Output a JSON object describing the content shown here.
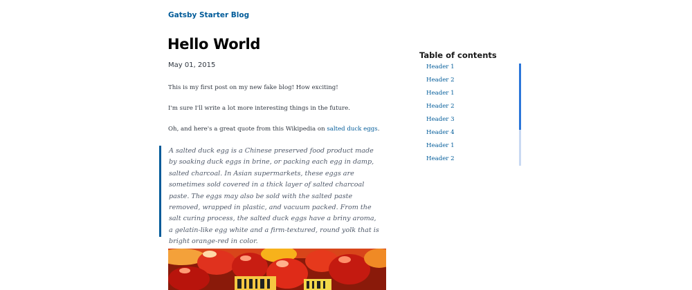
{
  "header": {
    "site_title": "Gatsby Starter Blog"
  },
  "post": {
    "title": "Hello World",
    "date": "May 01, 2015",
    "paragraphs": {
      "p1": "This is my first post on my new fake blog! How exciting!",
      "p2": "I'm sure I'll write a lot more interesting things in the future.",
      "p3_before_link": "Oh, and here's a great quote from this Wikipedia on ",
      "p3_link": "salted duck eggs",
      "p3_after_link": "."
    },
    "blockquote": "A salted duck egg is a Chinese preserved food product made by soaking duck eggs in brine, or packing each egg in damp, salted charcoal. In Asian supermarkets, these eggs are sometimes sold covered in a thick layer of salted charcoal paste. The eggs may also be sold with the salted paste removed, wrapped in plastic, and vacuum packed. From the salt curing process, the salted duck eggs have a briny aroma, a gelatin-like egg white and a firm-textured, round yolk that is bright orange-red in color.",
    "photo_label": "salted duck eggs photo"
  },
  "toc": {
    "title": "Table of contents",
    "items": [
      "Header 1",
      "Header 2",
      "Header 1",
      "Header 2",
      "Header 3",
      "Header 4",
      "Header 1",
      "Header 2"
    ],
    "scroll_progress": 0.65
  },
  "colors": {
    "link": "#005b99",
    "quote_border": "#005b99",
    "toc_track": "#c9d9f2",
    "toc_thumb": "#2b76d9"
  }
}
